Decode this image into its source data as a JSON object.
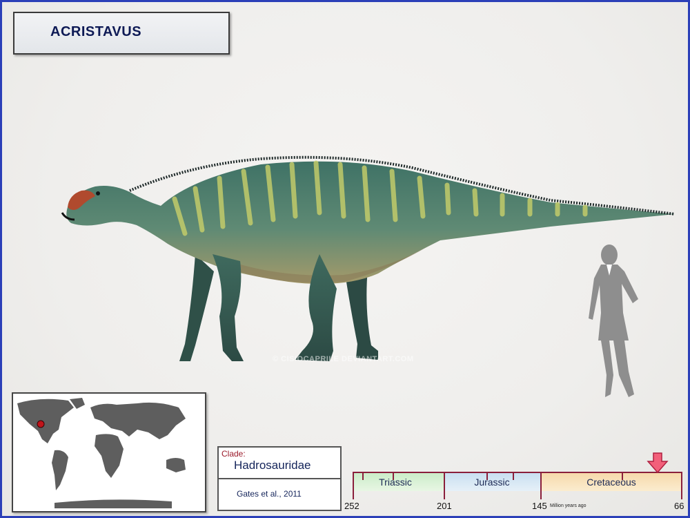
{
  "title": "ACRISTAVUS",
  "watermark": "© CISIOCAPRILE DEVIANTART.COM",
  "clade": {
    "label": "Clade:",
    "value": "Hadrosauridae",
    "author": "Gates et al., 2011"
  },
  "timeline": {
    "periods": [
      "Triassic",
      "Jurassic",
      "Cretaceous"
    ],
    "ticks": [
      "252",
      "201",
      "145",
      "66"
    ],
    "unit": "Million years ago"
  },
  "map": {
    "location_marker": "western North America",
    "marker_color": "#c0141a"
  },
  "colors": {
    "border": "#2b3fb8",
    "triassic": "#c9ecc6",
    "jurassic": "#c6def0",
    "cretaceous": "#f6d8a8",
    "arrow": "#f2607a"
  }
}
